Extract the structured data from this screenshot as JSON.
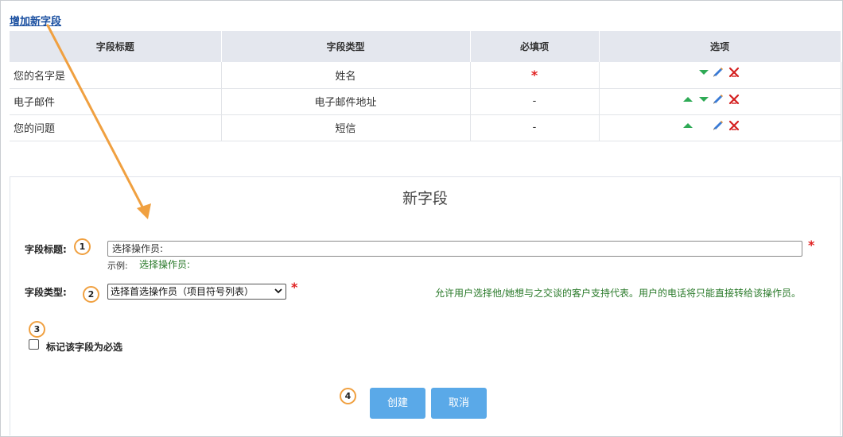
{
  "add_field_link": "增加新字段",
  "table": {
    "headers": [
      "字段标题",
      "字段类型",
      "必填项",
      "选项"
    ],
    "rows": [
      {
        "title": "您的名字是",
        "type": "姓名",
        "required": "*",
        "options": [
          "down-arrow-icon",
          "edit-pencil-icon",
          "delete-x-icon"
        ]
      },
      {
        "title": "电子邮件",
        "type": "电子邮件地址",
        "required": "-",
        "options": [
          "up-arrow-icon",
          "down-arrow-icon",
          "edit-pencil-icon",
          "delete-x-icon"
        ]
      },
      {
        "title": "您的问题",
        "type": "短信",
        "required": "-",
        "options": [
          "up-arrow-icon",
          "edit-pencil-icon",
          "delete-x-icon"
        ]
      }
    ]
  },
  "new_field": {
    "title": "新字段",
    "field_title_label": "字段标题:",
    "field_title_value": "选择操作员:",
    "example_label": "示例:",
    "example_value": "选择操作员:",
    "field_type_label": "字段类型:",
    "field_type_selected": "选择首选操作员（项目符号列表）",
    "field_type_hint": "允许用户选择他/她想与之交谈的客户支持代表。用户的电话将只能直接转给该操作员。",
    "required_checkbox_label": "标记该字段为必选",
    "required_marker": "*",
    "create_button": "创建",
    "cancel_button": "取消"
  },
  "annotation_badges": [
    "1",
    "2",
    "3",
    "4"
  ],
  "colors": {
    "link": "#1a4fa0",
    "header_bg": "#e4e7ee",
    "required_star": "#e02020",
    "arrow_up_down": "#2eaa55",
    "hint_green": "#2a7a2a",
    "button_blue": "#5aa9e8",
    "annotation_orange": "#f0a040"
  }
}
